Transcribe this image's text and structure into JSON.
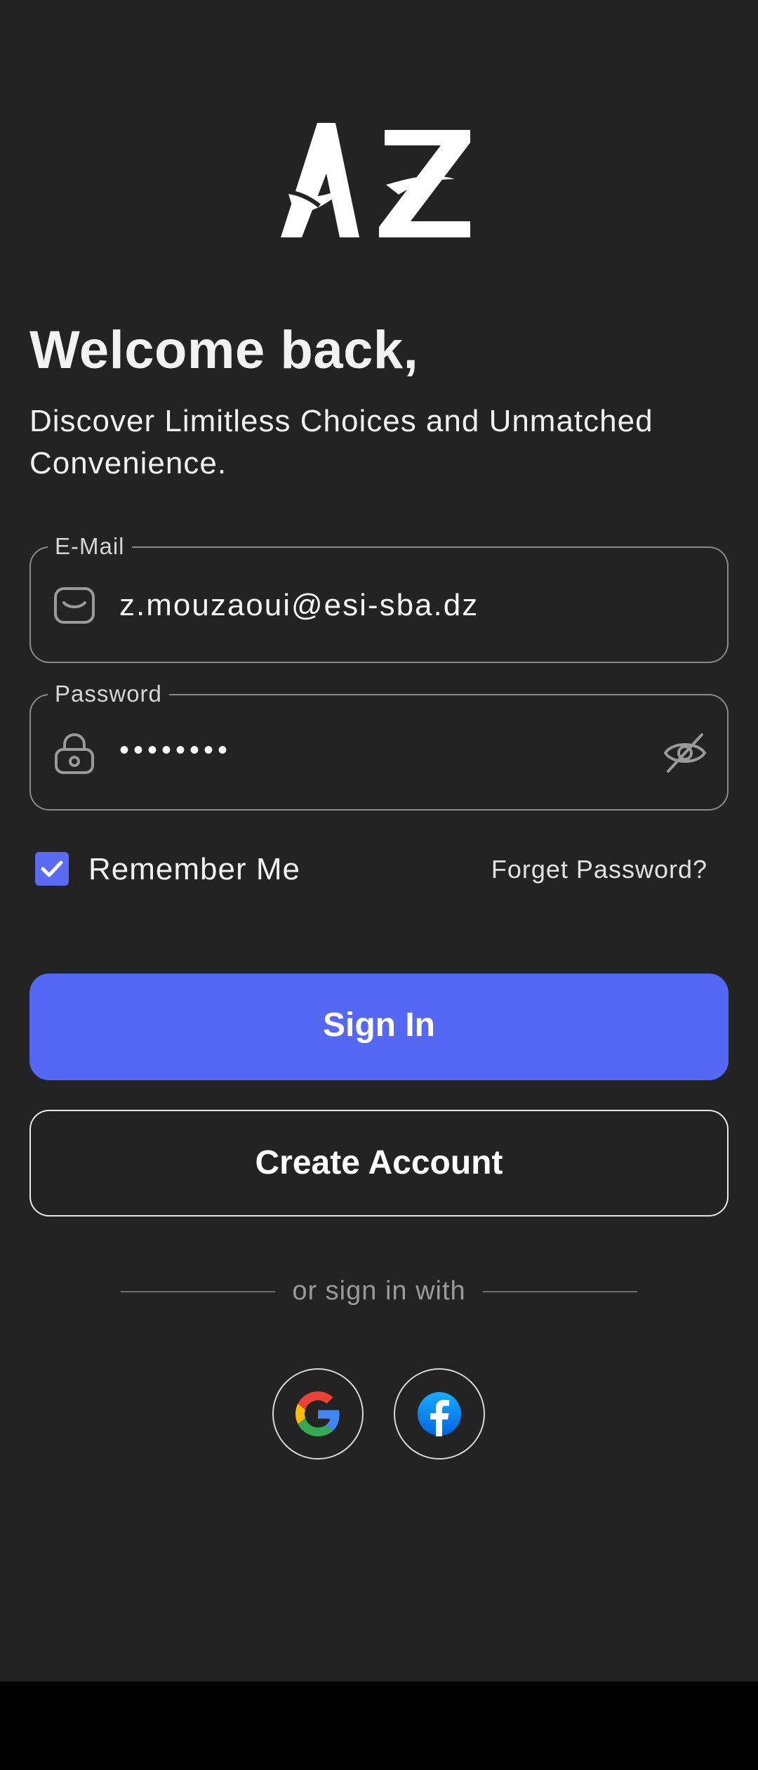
{
  "brand": {
    "logo_text": "AZ"
  },
  "header": {
    "title": "Welcome back,",
    "subtitle": "Discover Limitless Choices and Unmatched Convenience."
  },
  "form": {
    "email": {
      "label": "E-Mail",
      "value": "z.mouzaoui@esi-sba.dz",
      "icon": "mail-icon"
    },
    "password": {
      "label": "Password",
      "value": "••••••••",
      "icon": "lock-icon",
      "toggle_icon": "eye-off-icon"
    },
    "remember_me": {
      "label": "Remember Me",
      "checked": true
    },
    "forgot_password": "Forget Password?"
  },
  "buttons": {
    "sign_in": "Sign In",
    "create_account": "Create Account"
  },
  "social": {
    "divider_text": "or sign in with",
    "providers": [
      "google",
      "facebook"
    ]
  },
  "colors": {
    "background": "#232323",
    "accent": "#5568f4",
    "border": "#8a8a8a"
  }
}
